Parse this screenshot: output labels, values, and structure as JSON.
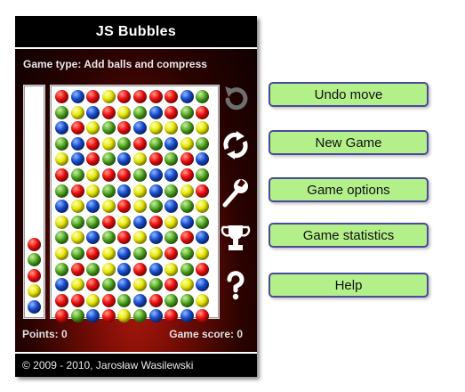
{
  "title": "JS Bubbles",
  "game_type": {
    "label": "Game type:",
    "value": "Add balls and compress"
  },
  "queue": [
    "red",
    "green",
    "red",
    "yellow",
    "blue"
  ],
  "board": [
    [
      "red",
      "blue",
      "red",
      "yellow",
      "red",
      "red",
      "red",
      "red",
      "blue",
      "green"
    ],
    [
      "green",
      "yellow",
      "blue",
      "red",
      "yellow",
      "green",
      "blue",
      "red",
      "green",
      "red"
    ],
    [
      "blue",
      "red",
      "yellow",
      "green",
      "red",
      "blue",
      "yellow",
      "yellow",
      "green",
      "yellow"
    ],
    [
      "green",
      "blue",
      "red",
      "yellow",
      "green",
      "red",
      "green",
      "blue",
      "yellow",
      "green"
    ],
    [
      "yellow",
      "blue",
      "red",
      "green",
      "blue",
      "yellow",
      "red",
      "green",
      "red",
      "blue"
    ],
    [
      "red",
      "green",
      "yellow",
      "red",
      "red",
      "green",
      "blue",
      "blue",
      "red",
      "green"
    ],
    [
      "green",
      "red",
      "yellow",
      "green",
      "blue",
      "yellow",
      "blue",
      "green",
      "yellow",
      "red"
    ],
    [
      "blue",
      "yellow",
      "blue",
      "yellow",
      "red",
      "yellow",
      "green",
      "blue",
      "green",
      "yellow"
    ],
    [
      "yellow",
      "green",
      "green",
      "red",
      "yellow",
      "blue",
      "red",
      "yellow",
      "blue",
      "green"
    ],
    [
      "green",
      "yellow",
      "blue",
      "green",
      "red",
      "yellow",
      "blue",
      "green",
      "red",
      "blue"
    ],
    [
      "yellow",
      "green",
      "red",
      "yellow",
      "blue",
      "green",
      "yellow",
      "red",
      "green",
      "yellow"
    ],
    [
      "green",
      "red",
      "green",
      "yellow",
      "blue",
      "red",
      "blue",
      "yellow",
      "green",
      "red"
    ],
    [
      "blue",
      "yellow",
      "red",
      "green",
      "blue",
      "yellow",
      "green",
      "red",
      "yellow",
      "blue"
    ],
    [
      "red",
      "red",
      "yellow",
      "red",
      "green",
      "blue",
      "red",
      "green",
      "green",
      "yellow"
    ],
    [
      "red",
      "green",
      "blue",
      "red",
      "yellow",
      "green",
      "blue",
      "red",
      "blue",
      "red"
    ]
  ],
  "status": {
    "points": "Points: 0",
    "game_score": "Game score: 0"
  },
  "footer": "© 2009 - 2010, Jarosław Wasilewski",
  "menu": {
    "undo": "Undo move",
    "new_game": "New Game",
    "options": "Game options",
    "statistics": "Game statistics",
    "help": "Help"
  },
  "colors": {
    "red": "#f01010",
    "blue": "#1a4fd0",
    "green": "#4ca21c",
    "yellow": "#e6e600",
    "button_bg": "#b3f08a",
    "button_border": "#4a4a9a"
  },
  "icons": [
    "undo-icon",
    "new-game-icon",
    "wrench-icon",
    "trophy-icon",
    "help-icon"
  ]
}
